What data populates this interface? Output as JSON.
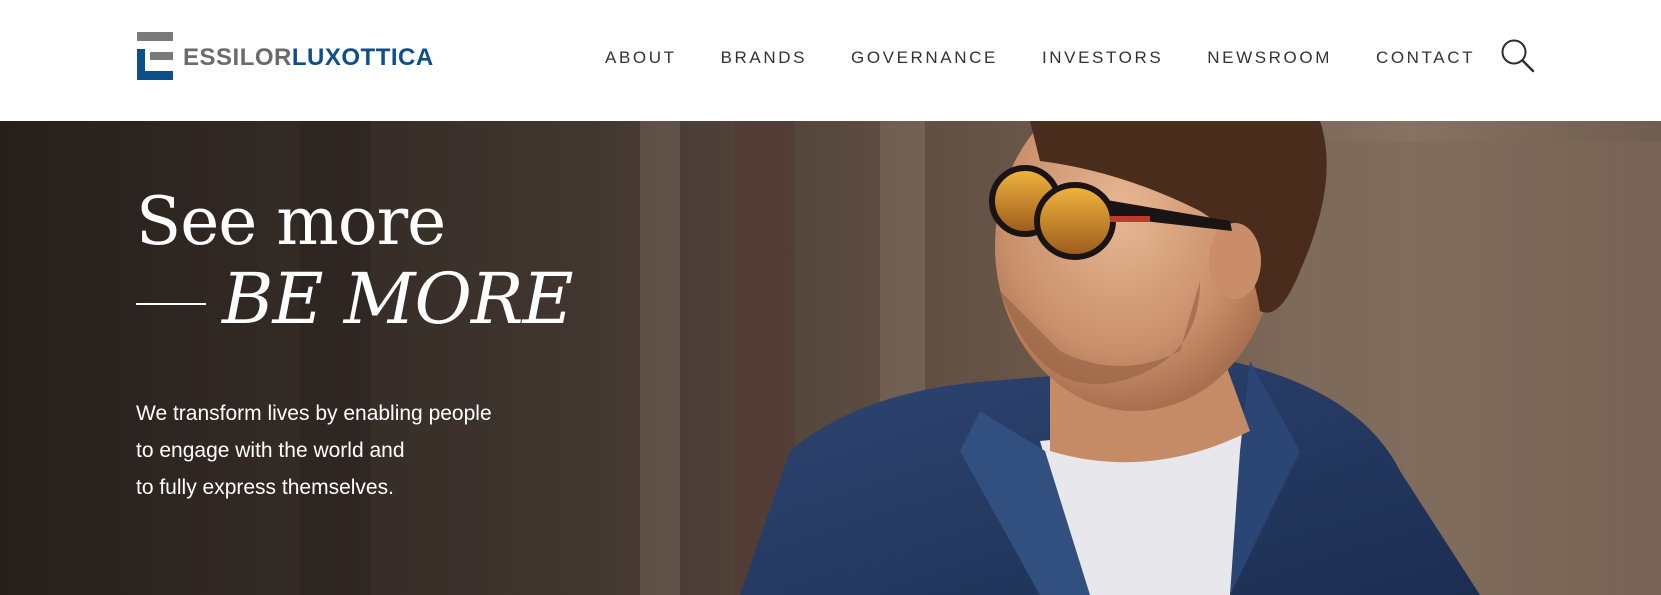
{
  "header": {
    "logo": {
      "part1": "ESSILOR",
      "part2": "LUXOTTICA",
      "icon": "essilorluxottica-e-logo-icon"
    },
    "nav": [
      {
        "label": "ABOUT"
      },
      {
        "label": "BRANDS"
      },
      {
        "label": "GOVERNANCE"
      },
      {
        "label": "INVESTORS"
      },
      {
        "label": "NEWSROOM"
      },
      {
        "label": "CONTACT"
      }
    ],
    "search_icon": "search-icon"
  },
  "hero": {
    "title_line1": "See more",
    "title_line2": "BE MORE",
    "tagline": [
      "We transform lives by enabling people",
      "to engage with the world and",
      "to fully express themselves."
    ],
    "image": "man-wearing-sunglasses-photo"
  },
  "colors": {
    "brand_gray": "#6b6b6b",
    "brand_blue": "#0d4f8b",
    "nav_text": "#333333",
    "hero_text": "#ffffff"
  }
}
